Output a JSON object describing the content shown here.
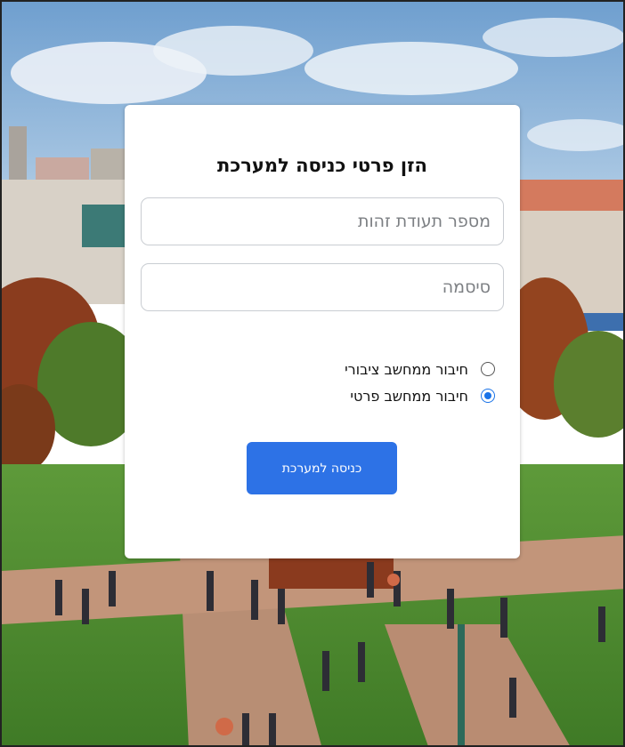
{
  "login": {
    "title": "הזן פרטי כניסה למערכת",
    "id_placeholder": "מספר תעודת זהות",
    "password_placeholder": "סיסמה",
    "options": [
      {
        "label": "חיבור ממחשב ציבורי",
        "selected": false
      },
      {
        "label": "חיבור ממחשב פרטי",
        "selected": true
      }
    ],
    "submit_label": "כניסה למערכת"
  },
  "colors": {
    "accent": "#2d72e6",
    "card_bg": "#ffffff"
  }
}
